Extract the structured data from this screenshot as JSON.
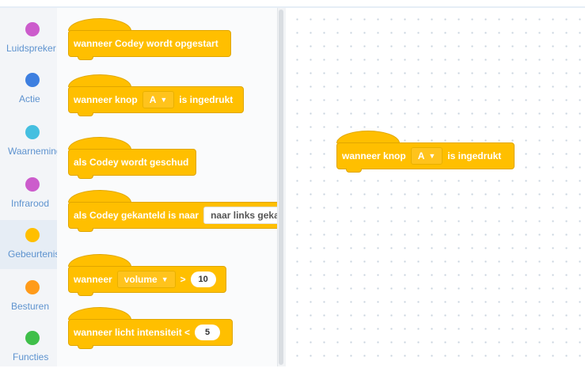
{
  "categories": [
    {
      "label": "Luidspreker",
      "color": "#cc5ccc",
      "icon": "circle-icon"
    },
    {
      "label": "Actie",
      "color": "#3d7fe0",
      "icon": "circle-icon"
    },
    {
      "label": "Waarneming",
      "color": "#45bfe0",
      "icon": "circle-icon"
    },
    {
      "label": "Infrarood",
      "color": "#cc5ccc",
      "icon": "circle-icon"
    },
    {
      "label": "Gebeurtenissen",
      "color": "#ffbf00",
      "icon": "circle-icon",
      "selected": true
    },
    {
      "label": "Besturen",
      "color": "#ff9b1a",
      "icon": "circle-icon"
    },
    {
      "label": "Functies",
      "color": "#3fbf4a",
      "icon": "circle-icon"
    }
  ],
  "palette": {
    "codey_start": "wanneer Codey wordt opgestart",
    "button_pressed": {
      "prefix": "wanneer knop",
      "option": "A",
      "suffix": "is ingedrukt"
    },
    "codey_shaken": "als Codey wordt geschud",
    "codey_tilted": {
      "prefix": "als Codey gekanteld is naar",
      "option": "naar links gekanteld"
    },
    "volume": {
      "prefix": "wanneer",
      "option": "volume",
      "operator": ">",
      "value": "10"
    },
    "light": {
      "prefix": "wanneer licht intensiteit <",
      "value": "5"
    }
  },
  "workspace": {
    "button_pressed": {
      "prefix": "wanneer knop",
      "option": "A",
      "suffix": "is ingedrukt"
    }
  },
  "colors": {
    "event_block": "#ffbf00",
    "selected_category": "#e6edf5"
  }
}
